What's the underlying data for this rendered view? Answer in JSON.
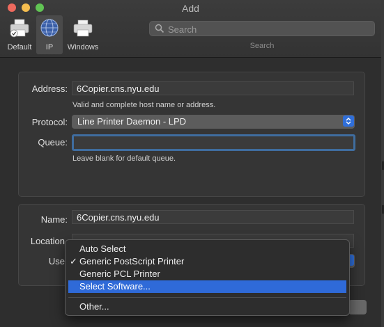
{
  "window": {
    "title": "Add"
  },
  "toolbar": {
    "items": [
      {
        "label": "Default",
        "icon": "printer-icon"
      },
      {
        "label": "IP",
        "icon": "globe-icon"
      },
      {
        "label": "Windows",
        "icon": "printer-icon"
      }
    ],
    "search": {
      "placeholder": "Search",
      "label": "Search"
    }
  },
  "form": {
    "address_label": "Address:",
    "address_value": "6Copier.cns.nyu.edu",
    "address_hint": "Valid and complete host name or address.",
    "protocol_label": "Protocol:",
    "protocol_value": "Line Printer Daemon - LPD",
    "queue_label": "Queue:",
    "queue_value": "",
    "queue_hint": "Leave blank for default queue.",
    "name_label": "Name:",
    "name_value": "6Copier.cns.nyu.edu",
    "location_label": "Location",
    "use_label": "Use"
  },
  "menu": {
    "items": [
      {
        "label": "Auto Select",
        "checked": false,
        "highlighted": false
      },
      {
        "label": "Generic PostScript Printer",
        "checked": true,
        "highlighted": false
      },
      {
        "label": "Generic PCL Printer",
        "checked": false,
        "highlighted": false
      },
      {
        "label": "Select Software...",
        "checked": false,
        "highlighted": true
      },
      {
        "label": "Other...",
        "checked": false,
        "highlighted": false
      }
    ],
    "checkmark": "✓"
  },
  "colors": {
    "accent": "#2f6ad8",
    "focus_ring": "#3f6d9f",
    "traffic_close": "#ee6a5e",
    "traffic_min": "#f5bd4f",
    "traffic_max": "#61c454"
  }
}
